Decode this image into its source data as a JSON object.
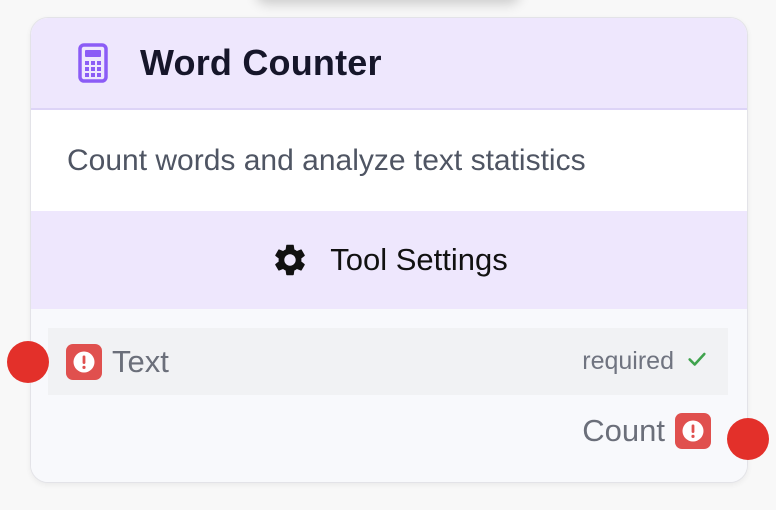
{
  "node": {
    "title": "Word Counter",
    "description": "Count words and analyze text statistics",
    "header_icon": "calculator-icon",
    "accent_color": "#8b5cf6",
    "header_bg": "#eee7fd"
  },
  "settings": {
    "label": "Tool Settings",
    "icon": "gear-icon"
  },
  "inputs": [
    {
      "label": "Text",
      "status": "required",
      "status_icon": "check-icon",
      "badge_icon": "alert-icon",
      "badge_color": "#e0504e"
    }
  ],
  "outputs": [
    {
      "label": "Count",
      "badge_icon": "alert-icon",
      "badge_color": "#e0504e"
    }
  ],
  "handles": {
    "color": "#e3302a"
  }
}
